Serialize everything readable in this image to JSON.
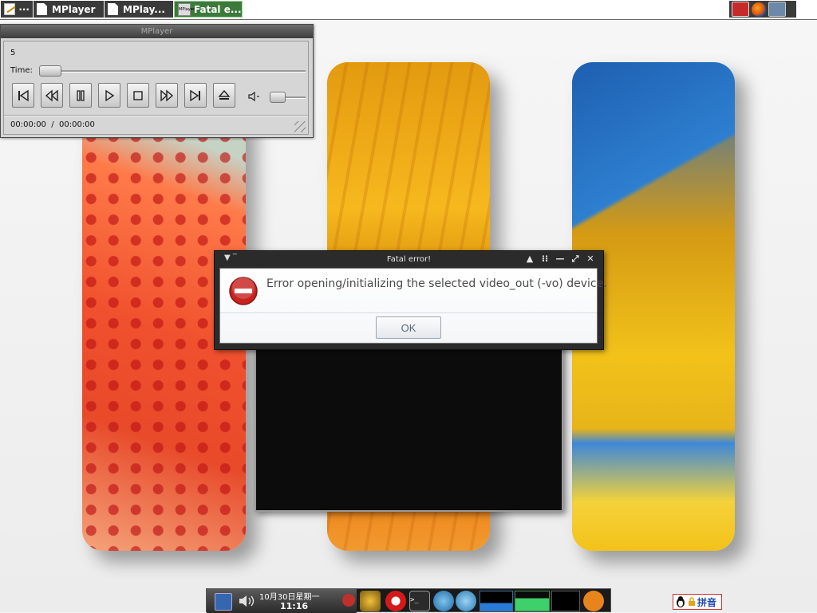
{
  "top_taskbar": {
    "launcher_dots": "···",
    "tasks": [
      {
        "label": "MPlayer",
        "active": false
      },
      {
        "label": "MPlay...",
        "active": false
      },
      {
        "label": "Fatal e...",
        "active": true,
        "icon_text": "MPlayer"
      }
    ]
  },
  "mplayer": {
    "title": "MPlayer",
    "track_number": "5",
    "time_label": "Time:",
    "elapsed": "00:00:00  /  00:00:00",
    "seek_position": 0,
    "volume_position": 0,
    "buttons": [
      "previous",
      "rewind",
      "pause",
      "play",
      "stop",
      "fast-forward",
      "next",
      "eject"
    ]
  },
  "dialog": {
    "title": "Fatal error!",
    "message": "Error opening/initializing the selected video_out (-vo) device.",
    "ok_label": "OK",
    "controls": [
      "▲",
      "⁝⁝",
      "—",
      "⤢",
      "✕"
    ]
  },
  "dock": {
    "date": "10月30日星期一",
    "time": "11:16"
  },
  "ime": {
    "label": "拼音"
  },
  "colors": {
    "active_task": "#3c7a3c",
    "taskbar_dark": "#3a3a3a",
    "dialog_frame": "#2b2b2b",
    "error_red": "#c8231f"
  }
}
